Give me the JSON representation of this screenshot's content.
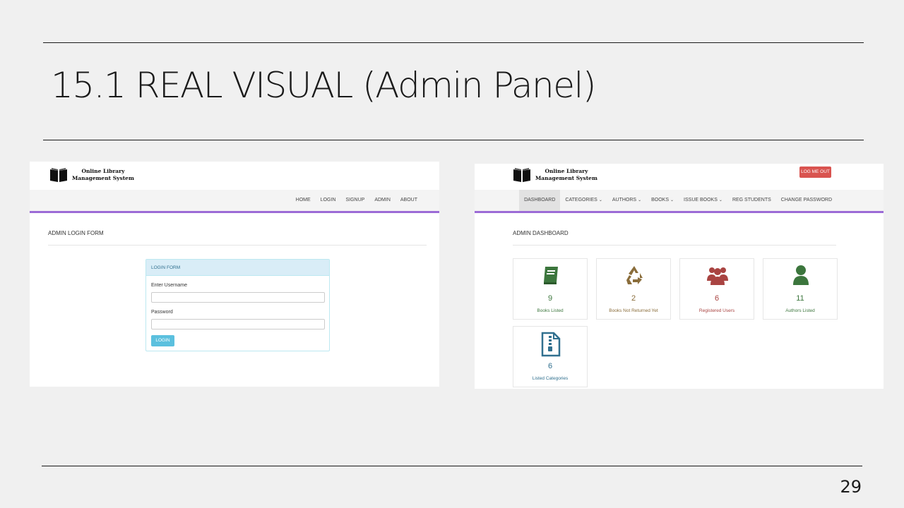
{
  "slide": {
    "title": "15.1 REAL VISUAL (Admin Panel)",
    "page_number": "29"
  },
  "login_screen": {
    "brand": {
      "line1": "Online Library",
      "line2": "Management System"
    },
    "nav": [
      "HOME",
      "LOGIN",
      "SIGNUP",
      "ADMIN",
      "ABOUT"
    ],
    "heading": "ADMIN LOGIN FORM",
    "panel_title": "LOGIN FORM",
    "username_label": "Enter Username",
    "username_value": "",
    "password_label": "Password",
    "password_value": "",
    "login_button": "LOGIN"
  },
  "dashboard_screen": {
    "brand": {
      "line1": "Online Library",
      "line2": "Management System"
    },
    "logout_button": "LOG ME OUT",
    "nav": [
      {
        "label": "DASHBOARD",
        "active": true,
        "dropdown": false
      },
      {
        "label": "CATEGORIES",
        "active": false,
        "dropdown": true
      },
      {
        "label": "AUTHORS",
        "active": false,
        "dropdown": true
      },
      {
        "label": "BOOKS",
        "active": false,
        "dropdown": true
      },
      {
        "label": "ISSUE BOOKS",
        "active": false,
        "dropdown": true
      },
      {
        "label": "REG STUDENTS",
        "active": false,
        "dropdown": false
      },
      {
        "label": "CHANGE PASSWORD",
        "active": false,
        "dropdown": false
      }
    ],
    "heading": "ADMIN DASHBOARD",
    "cards": [
      {
        "count": "9",
        "label": "Books Listed",
        "icon": "book-icon",
        "color": "#3c763d"
      },
      {
        "count": "2",
        "label": "Books Not Returned Yet",
        "icon": "recycle-icon",
        "color": "#8a6d3b"
      },
      {
        "count": "6",
        "label": "Registered Users",
        "icon": "users-icon",
        "color": "#a94442"
      },
      {
        "count": "11",
        "label": "Authors Listed",
        "icon": "user-icon",
        "color": "#3c763d"
      },
      {
        "count": "6",
        "label": "Listed Categories",
        "icon": "file-archive-icon",
        "color": "#31708f"
      }
    ]
  },
  "colors": {
    "nav_border": "#9c6bd6",
    "panel_header": "#d9edf7",
    "login_button": "#5bc0de",
    "logout_button": "#d9534f"
  }
}
